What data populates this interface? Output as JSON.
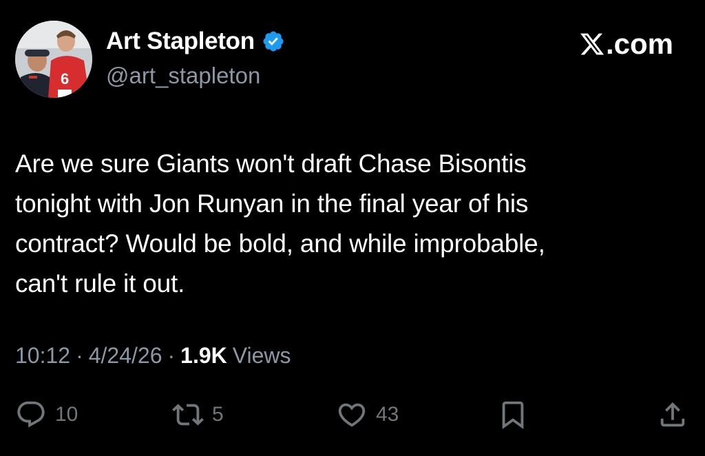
{
  "author": {
    "display_name": "Art Stapleton",
    "handle": "@art_stapleton",
    "verified": true,
    "avatar_icon": "profile-photo"
  },
  "brand": {
    "label": ".com",
    "icon": "x-logo-icon"
  },
  "tweet": {
    "text": "Are we sure Giants won't draft Chase Bisontis\ntonight with Jon Runyan in the final year of his\ncontract? Would be bold, and while improbable,\ncan't rule it out."
  },
  "meta": {
    "time": "10:12",
    "separator": "·",
    "date": "4/24/26",
    "views_count": "1.9K",
    "views_label": "Views"
  },
  "actions": {
    "replies": "10",
    "reposts": "5",
    "likes": "43"
  },
  "colors": {
    "background": "#000000",
    "text_primary": "#ffffff",
    "text_secondary": "#8b98a5",
    "icon_gray": "#71767b",
    "verified_blue": "#1d9bf0"
  }
}
